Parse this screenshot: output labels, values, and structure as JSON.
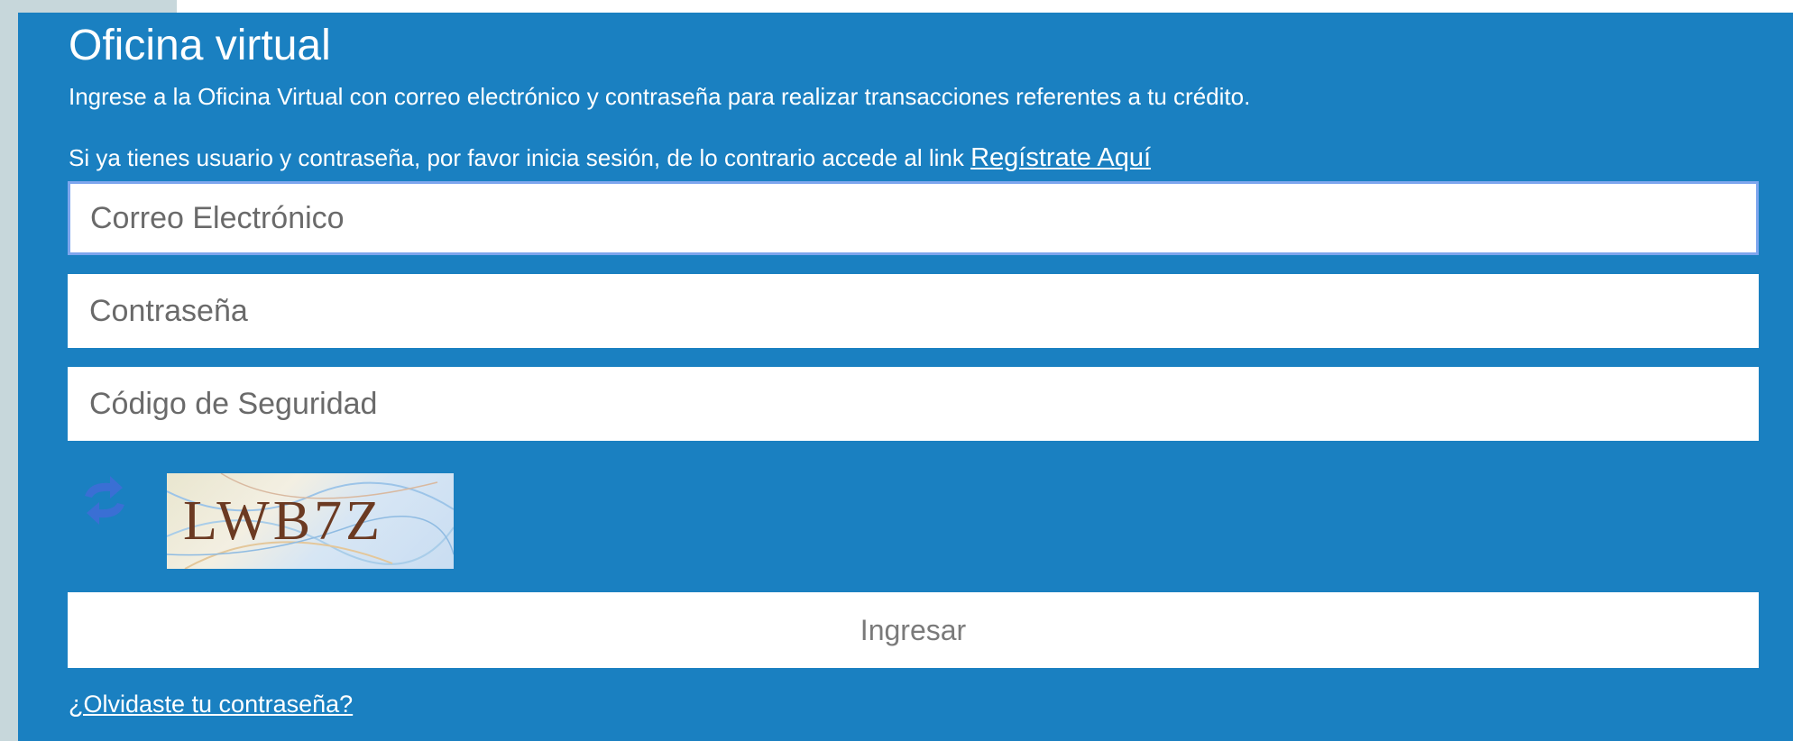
{
  "header": {
    "title": "Oficina virtual",
    "description": "Ingrese a la Oficina Virtual con correo electrónico y contraseña para realizar transacciones referentes a tu crédito.",
    "register_prompt": "Si ya tienes usuario y contraseña, por favor inicia sesión, de lo contrario accede al link",
    "register_link": "Regístrate Aquí"
  },
  "form": {
    "email_placeholder": "Correo Electrónico",
    "password_placeholder": "Contraseña",
    "security_code_placeholder": "Código de Seguridad",
    "captcha_text": "LWB7Z",
    "refresh_icon": "refresh-captcha-icon",
    "submit_label": "Ingresar",
    "forgot_password": "¿Olvidaste tu contraseña?"
  },
  "colors": {
    "panel_background": "#1a80c1",
    "page_background": "#c7d7db",
    "focus_border": "#7ea6ee",
    "refresh_icon": "#3a6fd4"
  }
}
